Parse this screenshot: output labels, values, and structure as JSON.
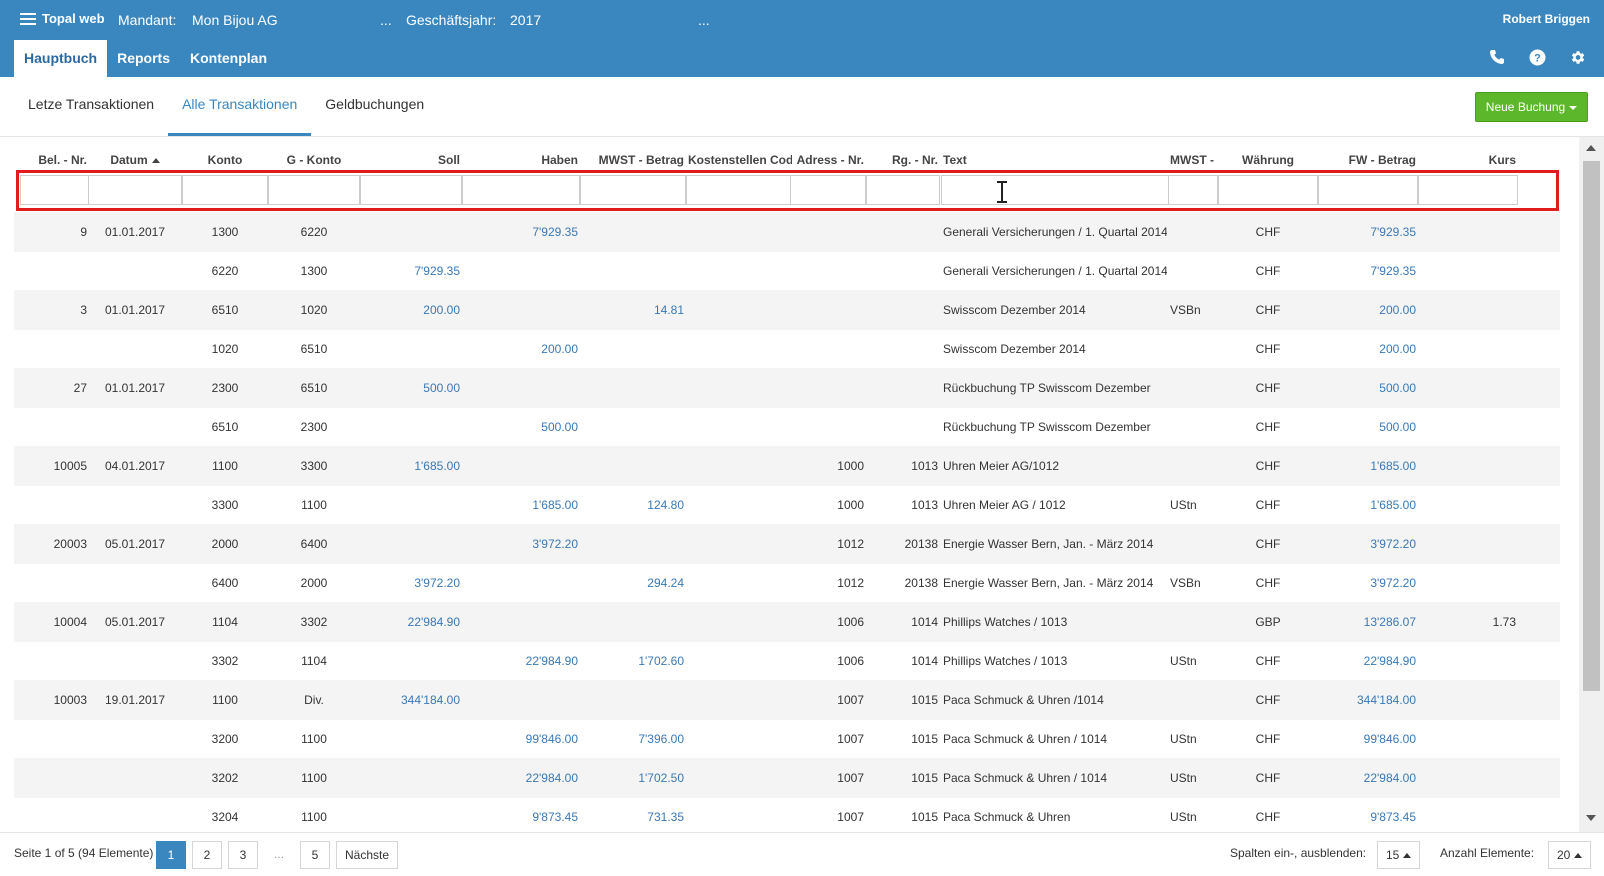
{
  "app": {
    "brand": "Topal web",
    "mandant_label": "Mandant:",
    "mandant_value": "Mon Bijou AG",
    "mandant_more": "...",
    "year_label": "Geschäftsjahr:",
    "year_value": "2017",
    "year_more": "...",
    "user": "Robert Briggen"
  },
  "nav": {
    "tabs": [
      {
        "label": "Hauptbuch"
      },
      {
        "label": "Reports"
      },
      {
        "label": "Kontenplan"
      }
    ],
    "icons": [
      "phone-icon",
      "help-icon",
      "gear-icon"
    ]
  },
  "subnav": {
    "tabs": [
      {
        "label": "Letze Transaktionen"
      },
      {
        "label": "Alle Transaktionen"
      },
      {
        "label": "Geldbuchungen"
      }
    ],
    "new_button": "Neue Buchung"
  },
  "table": {
    "columns": [
      {
        "key": "bel",
        "label": "Bel. - Nr."
      },
      {
        "key": "datum",
        "label": "Datum"
      },
      {
        "key": "konto",
        "label": "Konto"
      },
      {
        "key": "gkonto",
        "label": "G - Konto"
      },
      {
        "key": "soll",
        "label": "Soll"
      },
      {
        "key": "haben",
        "label": "Haben"
      },
      {
        "key": "mwstb",
        "label": "MWST - Betrag"
      },
      {
        "key": "kst",
        "label": "Kostenstellen Cod"
      },
      {
        "key": "adr",
        "label": "Adress - Nr."
      },
      {
        "key": "rg",
        "label": "Rg. - Nr."
      },
      {
        "key": "text",
        "label": "Text"
      },
      {
        "key": "mwstc",
        "label": "MWST - C"
      },
      {
        "key": "waehrung",
        "label": "Währung"
      },
      {
        "key": "fw",
        "label": "FW - Betrag"
      },
      {
        "key": "kurs",
        "label": "Kurs"
      }
    ],
    "rows": [
      {
        "bel": "9",
        "datum": "01.01.2017",
        "konto": "1300",
        "gkonto": "6220",
        "soll": "",
        "haben": "7'929.35",
        "mwstb": "",
        "kst": "",
        "adr": "",
        "rg": "",
        "text": "Generali Versicherungen / 1. Quartal 2014",
        "mwstc": "",
        "waehrung": "CHF",
        "fw": "7'929.35",
        "kurs": ""
      },
      {
        "bel": "",
        "datum": "",
        "konto": "6220",
        "gkonto": "1300",
        "soll": "7'929.35",
        "haben": "",
        "mwstb": "",
        "kst": "",
        "adr": "",
        "rg": "",
        "text": "Generali Versicherungen / 1. Quartal 2014",
        "mwstc": "",
        "waehrung": "CHF",
        "fw": "7'929.35",
        "kurs": ""
      },
      {
        "bel": "3",
        "datum": "01.01.2017",
        "konto": "6510",
        "gkonto": "1020",
        "soll": "200.00",
        "haben": "",
        "mwstb": "14.81",
        "kst": "",
        "adr": "",
        "rg": "",
        "text": "Swisscom Dezember 2014",
        "mwstc": "VSBn",
        "waehrung": "CHF",
        "fw": "200.00",
        "kurs": ""
      },
      {
        "bel": "",
        "datum": "",
        "konto": "1020",
        "gkonto": "6510",
        "soll": "",
        "haben": "200.00",
        "mwstb": "",
        "kst": "",
        "adr": "",
        "rg": "",
        "text": "Swisscom Dezember 2014",
        "mwstc": "",
        "waehrung": "CHF",
        "fw": "200.00",
        "kurs": ""
      },
      {
        "bel": "27",
        "datum": "01.01.2017",
        "konto": "2300",
        "gkonto": "6510",
        "soll": "500.00",
        "haben": "",
        "mwstb": "",
        "kst": "",
        "adr": "",
        "rg": "",
        "text": "Rückbuchung TP Swisscom Dezember",
        "mwstc": "",
        "waehrung": "CHF",
        "fw": "500.00",
        "kurs": ""
      },
      {
        "bel": "",
        "datum": "",
        "konto": "6510",
        "gkonto": "2300",
        "soll": "",
        "haben": "500.00",
        "mwstb": "",
        "kst": "",
        "adr": "",
        "rg": "",
        "text": "Rückbuchung TP Swisscom Dezember",
        "mwstc": "",
        "waehrung": "CHF",
        "fw": "500.00",
        "kurs": ""
      },
      {
        "bel": "10005",
        "datum": "04.01.2017",
        "konto": "1100",
        "gkonto": "3300",
        "soll": "1'685.00",
        "haben": "",
        "mwstb": "",
        "kst": "",
        "adr": "1000",
        "rg": "1013",
        "text": "Uhren Meier AG/1012",
        "mwstc": "",
        "waehrung": "CHF",
        "fw": "1'685.00",
        "kurs": ""
      },
      {
        "bel": "",
        "datum": "",
        "konto": "3300",
        "gkonto": "1100",
        "soll": "",
        "haben": "1'685.00",
        "mwstb": "124.80",
        "kst": "",
        "adr": "1000",
        "rg": "1013",
        "text": "Uhren Meier AG / 1012",
        "mwstc": "UStn",
        "waehrung": "CHF",
        "fw": "1'685.00",
        "kurs": ""
      },
      {
        "bel": "20003",
        "datum": "05.01.2017",
        "konto": "2000",
        "gkonto": "6400",
        "soll": "",
        "haben": "3'972.20",
        "mwstb": "",
        "kst": "",
        "adr": "1012",
        "rg": "20138",
        "text": "Energie Wasser Bern, Jan. - März 2014",
        "mwstc": "",
        "waehrung": "CHF",
        "fw": "3'972.20",
        "kurs": ""
      },
      {
        "bel": "",
        "datum": "",
        "konto": "6400",
        "gkonto": "2000",
        "soll": "3'972.20",
        "haben": "",
        "mwstb": "294.24",
        "kst": "",
        "adr": "1012",
        "rg": "20138",
        "text": "Energie Wasser Bern, Jan. - März 2014",
        "mwstc": "VSBn",
        "waehrung": "CHF",
        "fw": "3'972.20",
        "kurs": ""
      },
      {
        "bel": "10004",
        "datum": "05.01.2017",
        "konto": "1104",
        "gkonto": "3302",
        "soll": "22'984.90",
        "haben": "",
        "mwstb": "",
        "kst": "",
        "adr": "1006",
        "rg": "1014",
        "text": "Phillips Watches / 1013",
        "mwstc": "",
        "waehrung": "GBP",
        "fw": "13'286.07",
        "kurs": "1.73"
      },
      {
        "bel": "",
        "datum": "",
        "konto": "3302",
        "gkonto": "1104",
        "soll": "",
        "haben": "22'984.90",
        "mwstb": "1'702.60",
        "kst": "",
        "adr": "1006",
        "rg": "1014",
        "text": "Phillips Watches / 1013",
        "mwstc": "UStn",
        "waehrung": "CHF",
        "fw": "22'984.90",
        "kurs": ""
      },
      {
        "bel": "10003",
        "datum": "19.01.2017",
        "konto": "1100",
        "gkonto": "Div.",
        "soll": "344'184.00",
        "haben": "",
        "mwstb": "",
        "kst": "",
        "adr": "1007",
        "rg": "1015",
        "text": "Paca Schmuck & Uhren /1014",
        "mwstc": "",
        "waehrung": "CHF",
        "fw": "344'184.00",
        "kurs": ""
      },
      {
        "bel": "",
        "datum": "",
        "konto": "3200",
        "gkonto": "1100",
        "soll": "",
        "haben": "99'846.00",
        "mwstb": "7'396.00",
        "kst": "",
        "adr": "1007",
        "rg": "1015",
        "text": "Paca Schmuck & Uhren / 1014",
        "mwstc": "UStn",
        "waehrung": "CHF",
        "fw": "99'846.00",
        "kurs": ""
      },
      {
        "bel": "",
        "datum": "",
        "konto": "3202",
        "gkonto": "1100",
        "soll": "",
        "haben": "22'984.00",
        "mwstb": "1'702.50",
        "kst": "",
        "adr": "1007",
        "rg": "1015",
        "text": "Paca Schmuck & Uhren / 1014",
        "mwstc": "UStn",
        "waehrung": "CHF",
        "fw": "22'984.00",
        "kurs": ""
      },
      {
        "bel": "",
        "datum": "",
        "konto": "3204",
        "gkonto": "1100",
        "soll": "",
        "haben": "9'873.45",
        "mwstb": "731.35",
        "kst": "",
        "adr": "1007",
        "rg": "1015",
        "text": "Paca Schmuck & Uhren",
        "mwstc": "UStn",
        "waehrung": "CHF",
        "fw": "9'873.45",
        "kurs": ""
      }
    ]
  },
  "footer": {
    "page_info": "Seite 1 of 5 (94 Elemente)",
    "pages": [
      "1",
      "2",
      "3",
      "...",
      "5"
    ],
    "next": "Nächste",
    "columns_label": "Spalten ein-, ausblenden:",
    "columns_value": "15",
    "count_label": "Anzahl Elemente:",
    "count_value": "20"
  }
}
